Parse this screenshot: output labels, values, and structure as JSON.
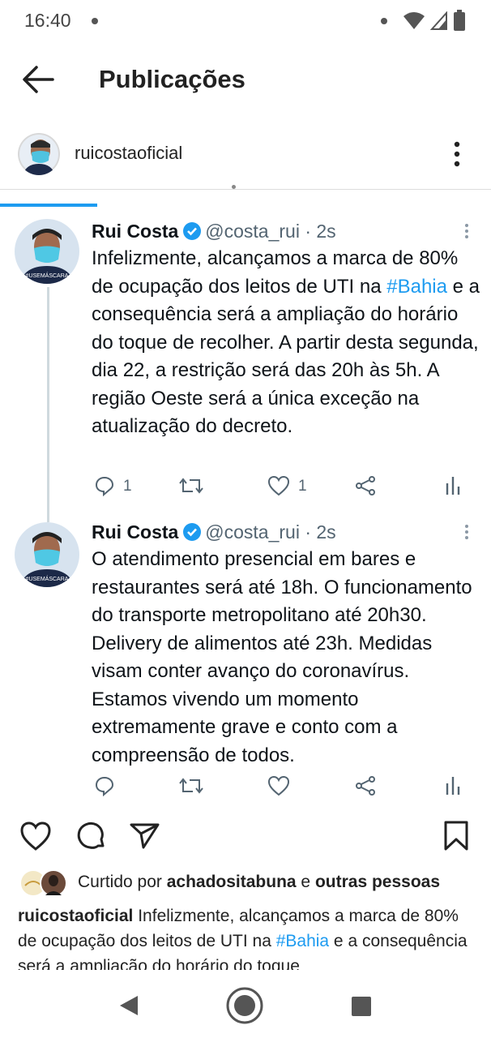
{
  "status_bar": {
    "time": "16:40"
  },
  "header": {
    "title": "Publicações"
  },
  "post": {
    "username": "ruicostaoficial"
  },
  "tweets": [
    {
      "name": "Rui Costa",
      "handle": "@costa_rui · 2s",
      "avatar_badge": "#USEMÁSCARA",
      "text_before": "Infelizmente, alcançamos a marca de 80% de ocupação dos leitos de UTI na ",
      "hashtag": "#Bahia",
      "text_after": " e a consequência será a ampliação do horário do toque de recolher. A partir desta segunda, dia 22, a restrição será das 20h às 5h. A região Oeste será a única exceção na atualização do decreto.",
      "replies": "1",
      "likes": "1"
    },
    {
      "name": "Rui Costa",
      "handle": "@costa_rui · 2s",
      "avatar_badge": "#USEMÁSCARA",
      "text": "O atendimento presencial em bares e restaurantes será até 18h. O funcionamento do transporte metropolitano até 20h30. Delivery de alimentos até 23h. Medidas visam conter avanço do coronavírus. Estamos vivendo um momento extremamente grave e conto com a compreensão de todos.",
      "replies": "",
      "likes": ""
    }
  ],
  "likes_line": {
    "prefix": "Curtido por ",
    "user": "achadositabuna",
    "middle": " e ",
    "others": "outras pessoas"
  },
  "caption": {
    "user": "ruicostaoficial",
    "text_before": " Infelizmente, alcançamos a marca de 80% de ocupação dos leitos de UTI na ",
    "hashtag": "#Bahia",
    "text_after": " e a consequência será a ampliação do horário do toque"
  },
  "colors": {
    "accent": "#1d9bf0",
    "text": "#0f1419",
    "muted": "#536471"
  },
  "icons": [
    "back-arrow-icon",
    "more-vertical-icon",
    "verified-icon",
    "reply-icon",
    "retweet-icon",
    "heart-icon",
    "share-icon",
    "analytics-icon",
    "comment-icon",
    "send-icon",
    "bookmark-icon"
  ]
}
